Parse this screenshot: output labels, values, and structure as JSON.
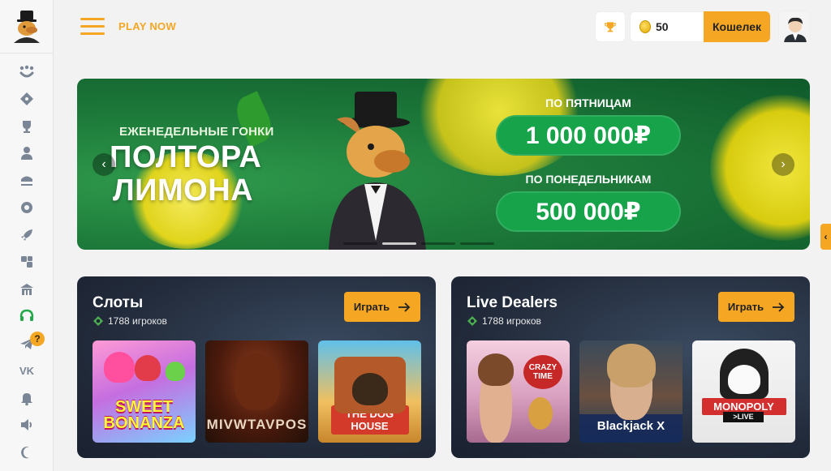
{
  "header": {
    "play_now_label": "PLAY NOW",
    "balance": "50",
    "wallet_label": "Кошелек"
  },
  "sidebar": {
    "items": [
      {
        "icon": "smile-icon"
      },
      {
        "icon": "ticket-icon"
      },
      {
        "icon": "trophy-cup-icon"
      },
      {
        "icon": "user-icon"
      },
      {
        "icon": "jackpot-icon"
      },
      {
        "icon": "spin-icon"
      },
      {
        "icon": "rocket-icon"
      },
      {
        "icon": "dice-icon"
      },
      {
        "icon": "casino-icon"
      },
      {
        "icon": "support-icon"
      },
      {
        "icon": "telegram-icon"
      },
      {
        "icon": "vk-icon"
      },
      {
        "icon": "bell-icon"
      },
      {
        "icon": "sound-icon"
      },
      {
        "icon": "moon-icon"
      }
    ],
    "help_badge": "?"
  },
  "banner": {
    "subtitle": "ЕЖЕНЕДЕЛЬНЫЕ ГОНКИ",
    "title_line1": "ПОЛТОРА",
    "title_line2": "ЛИМОНА",
    "prize1_label": "ПО ПЯТНИЦАМ",
    "prize1_value": "1 000 000₽",
    "prize2_label": "ПО ПОНЕДЕЛЬНИКАМ",
    "prize2_value": "500 000₽",
    "prev_arrow": "‹",
    "next_arrow": "›",
    "active_slide": 1,
    "slide_count": 4
  },
  "cards": {
    "slots": {
      "title": "Слоты",
      "players": "1788 игроков",
      "play_label": "Играть",
      "games": [
        {
          "label": "SWEET BONANZA"
        },
        {
          "label": "MIVWTAVPOS"
        },
        {
          "label": "THE DOG HOUSE"
        }
      ]
    },
    "live": {
      "title": "Live Dealers",
      "players": "1788 игроков",
      "play_label": "Играть",
      "games": [
        {
          "label": "CRAZY TIME"
        },
        {
          "label": "Blackjack X"
        },
        {
          "label": "MONOPOLY",
          "badge": ">LIVE"
        }
      ]
    }
  },
  "colors": {
    "accent": "#f5a623",
    "banner_green": "#1d7a3a",
    "pill_green": "#16a34a",
    "card_bg": "#232c3c"
  }
}
